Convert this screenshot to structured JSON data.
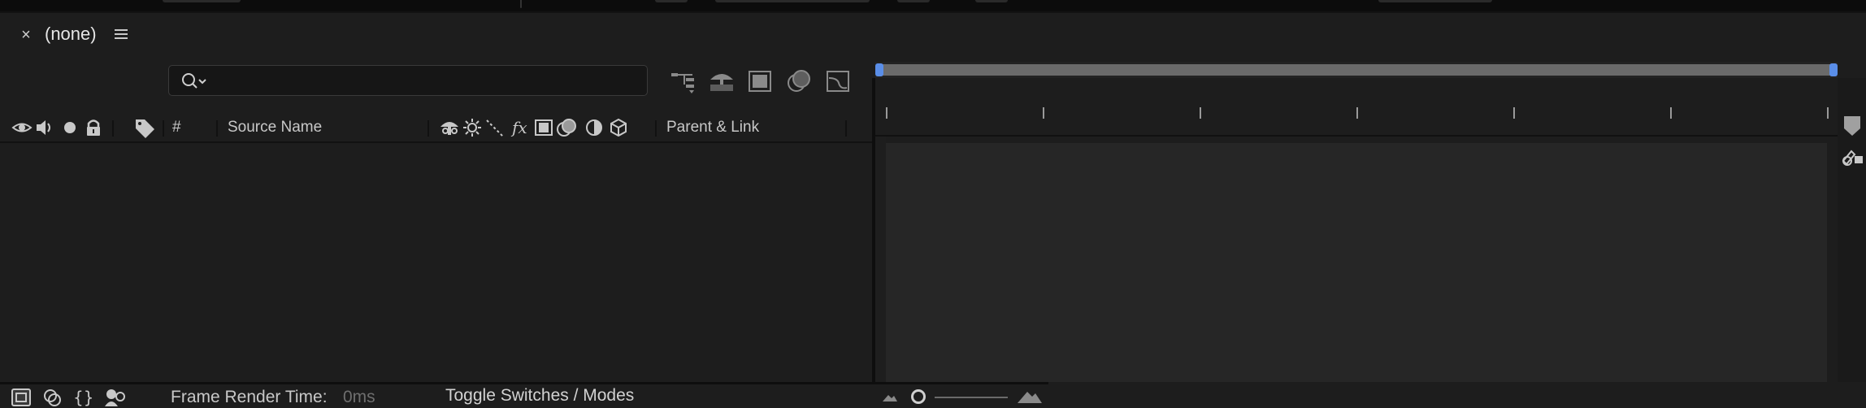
{
  "panel": {
    "close_label": "×",
    "title": "(none)",
    "menu_icon": "hamburger-menu-icon"
  },
  "search": {
    "value": "",
    "placeholder": "",
    "icon": "search-icon"
  },
  "toolbar_icons": [
    "composition-flowchart-icon",
    "draft-3d-icon",
    "frame-blending-icon",
    "motion-blur-icon",
    "graph-editor-icon"
  ],
  "columns": {
    "number": "#",
    "source_name": "Source Name",
    "parent_link": "Parent & Link",
    "switch_icons": [
      "shy-icon",
      "collapse-transformations-icon",
      "quality-icon",
      "effects-icon",
      "frame-blending-icon",
      "motion-blur-icon",
      "adjustment-layer-icon",
      "3d-layer-icon"
    ],
    "av_icons": [
      "eye-icon",
      "speaker-icon",
      "solo-dot-icon",
      "lock-icon"
    ],
    "label_icon": "label-tag-icon"
  },
  "bottom": {
    "frame_render_label": "Frame Render Time:",
    "frame_render_value": "0ms",
    "toggle_label": "Toggle Switches / Modes"
  },
  "colors": {
    "accent": "#5a8ee8",
    "panel_bg": "#1d1d1d",
    "graph_bg": "#262626"
  }
}
